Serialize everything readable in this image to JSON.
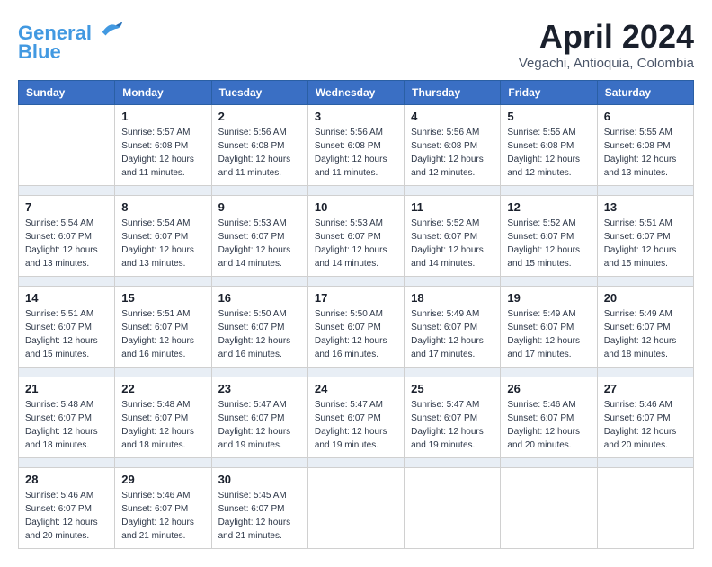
{
  "header": {
    "logo_line1": "General",
    "logo_line2": "Blue",
    "month_title": "April 2024",
    "location": "Vegachi, Antioquia, Colombia"
  },
  "weekdays": [
    "Sunday",
    "Monday",
    "Tuesday",
    "Wednesday",
    "Thursday",
    "Friday",
    "Saturday"
  ],
  "weeks": [
    [
      {
        "day": "",
        "sunrise": "",
        "sunset": "",
        "daylight": ""
      },
      {
        "day": "1",
        "sunrise": "Sunrise: 5:57 AM",
        "sunset": "Sunset: 6:08 PM",
        "daylight": "Daylight: 12 hours and 11 minutes."
      },
      {
        "day": "2",
        "sunrise": "Sunrise: 5:56 AM",
        "sunset": "Sunset: 6:08 PM",
        "daylight": "Daylight: 12 hours and 11 minutes."
      },
      {
        "day": "3",
        "sunrise": "Sunrise: 5:56 AM",
        "sunset": "Sunset: 6:08 PM",
        "daylight": "Daylight: 12 hours and 11 minutes."
      },
      {
        "day": "4",
        "sunrise": "Sunrise: 5:56 AM",
        "sunset": "Sunset: 6:08 PM",
        "daylight": "Daylight: 12 hours and 12 minutes."
      },
      {
        "day": "5",
        "sunrise": "Sunrise: 5:55 AM",
        "sunset": "Sunset: 6:08 PM",
        "daylight": "Daylight: 12 hours and 12 minutes."
      },
      {
        "day": "6",
        "sunrise": "Sunrise: 5:55 AM",
        "sunset": "Sunset: 6:08 PM",
        "daylight": "Daylight: 12 hours and 13 minutes."
      }
    ],
    [
      {
        "day": "7",
        "sunrise": "Sunrise: 5:54 AM",
        "sunset": "Sunset: 6:07 PM",
        "daylight": "Daylight: 12 hours and 13 minutes."
      },
      {
        "day": "8",
        "sunrise": "Sunrise: 5:54 AM",
        "sunset": "Sunset: 6:07 PM",
        "daylight": "Daylight: 12 hours and 13 minutes."
      },
      {
        "day": "9",
        "sunrise": "Sunrise: 5:53 AM",
        "sunset": "Sunset: 6:07 PM",
        "daylight": "Daylight: 12 hours and 14 minutes."
      },
      {
        "day": "10",
        "sunrise": "Sunrise: 5:53 AM",
        "sunset": "Sunset: 6:07 PM",
        "daylight": "Daylight: 12 hours and 14 minutes."
      },
      {
        "day": "11",
        "sunrise": "Sunrise: 5:52 AM",
        "sunset": "Sunset: 6:07 PM",
        "daylight": "Daylight: 12 hours and 14 minutes."
      },
      {
        "day": "12",
        "sunrise": "Sunrise: 5:52 AM",
        "sunset": "Sunset: 6:07 PM",
        "daylight": "Daylight: 12 hours and 15 minutes."
      },
      {
        "day": "13",
        "sunrise": "Sunrise: 5:51 AM",
        "sunset": "Sunset: 6:07 PM",
        "daylight": "Daylight: 12 hours and 15 minutes."
      }
    ],
    [
      {
        "day": "14",
        "sunrise": "Sunrise: 5:51 AM",
        "sunset": "Sunset: 6:07 PM",
        "daylight": "Daylight: 12 hours and 15 minutes."
      },
      {
        "day": "15",
        "sunrise": "Sunrise: 5:51 AM",
        "sunset": "Sunset: 6:07 PM",
        "daylight": "Daylight: 12 hours and 16 minutes."
      },
      {
        "day": "16",
        "sunrise": "Sunrise: 5:50 AM",
        "sunset": "Sunset: 6:07 PM",
        "daylight": "Daylight: 12 hours and 16 minutes."
      },
      {
        "day": "17",
        "sunrise": "Sunrise: 5:50 AM",
        "sunset": "Sunset: 6:07 PM",
        "daylight": "Daylight: 12 hours and 16 minutes."
      },
      {
        "day": "18",
        "sunrise": "Sunrise: 5:49 AM",
        "sunset": "Sunset: 6:07 PM",
        "daylight": "Daylight: 12 hours and 17 minutes."
      },
      {
        "day": "19",
        "sunrise": "Sunrise: 5:49 AM",
        "sunset": "Sunset: 6:07 PM",
        "daylight": "Daylight: 12 hours and 17 minutes."
      },
      {
        "day": "20",
        "sunrise": "Sunrise: 5:49 AM",
        "sunset": "Sunset: 6:07 PM",
        "daylight": "Daylight: 12 hours and 18 minutes."
      }
    ],
    [
      {
        "day": "21",
        "sunrise": "Sunrise: 5:48 AM",
        "sunset": "Sunset: 6:07 PM",
        "daylight": "Daylight: 12 hours and 18 minutes."
      },
      {
        "day": "22",
        "sunrise": "Sunrise: 5:48 AM",
        "sunset": "Sunset: 6:07 PM",
        "daylight": "Daylight: 12 hours and 18 minutes."
      },
      {
        "day": "23",
        "sunrise": "Sunrise: 5:47 AM",
        "sunset": "Sunset: 6:07 PM",
        "daylight": "Daylight: 12 hours and 19 minutes."
      },
      {
        "day": "24",
        "sunrise": "Sunrise: 5:47 AM",
        "sunset": "Sunset: 6:07 PM",
        "daylight": "Daylight: 12 hours and 19 minutes."
      },
      {
        "day": "25",
        "sunrise": "Sunrise: 5:47 AM",
        "sunset": "Sunset: 6:07 PM",
        "daylight": "Daylight: 12 hours and 19 minutes."
      },
      {
        "day": "26",
        "sunrise": "Sunrise: 5:46 AM",
        "sunset": "Sunset: 6:07 PM",
        "daylight": "Daylight: 12 hours and 20 minutes."
      },
      {
        "day": "27",
        "sunrise": "Sunrise: 5:46 AM",
        "sunset": "Sunset: 6:07 PM",
        "daylight": "Daylight: 12 hours and 20 minutes."
      }
    ],
    [
      {
        "day": "28",
        "sunrise": "Sunrise: 5:46 AM",
        "sunset": "Sunset: 6:07 PM",
        "daylight": "Daylight: 12 hours and 20 minutes."
      },
      {
        "day": "29",
        "sunrise": "Sunrise: 5:46 AM",
        "sunset": "Sunset: 6:07 PM",
        "daylight": "Daylight: 12 hours and 21 minutes."
      },
      {
        "day": "30",
        "sunrise": "Sunrise: 5:45 AM",
        "sunset": "Sunset: 6:07 PM",
        "daylight": "Daylight: 12 hours and 21 minutes."
      },
      {
        "day": "",
        "sunrise": "",
        "sunset": "",
        "daylight": ""
      },
      {
        "day": "",
        "sunrise": "",
        "sunset": "",
        "daylight": ""
      },
      {
        "day": "",
        "sunrise": "",
        "sunset": "",
        "daylight": ""
      },
      {
        "day": "",
        "sunrise": "",
        "sunset": "",
        "daylight": ""
      }
    ]
  ]
}
